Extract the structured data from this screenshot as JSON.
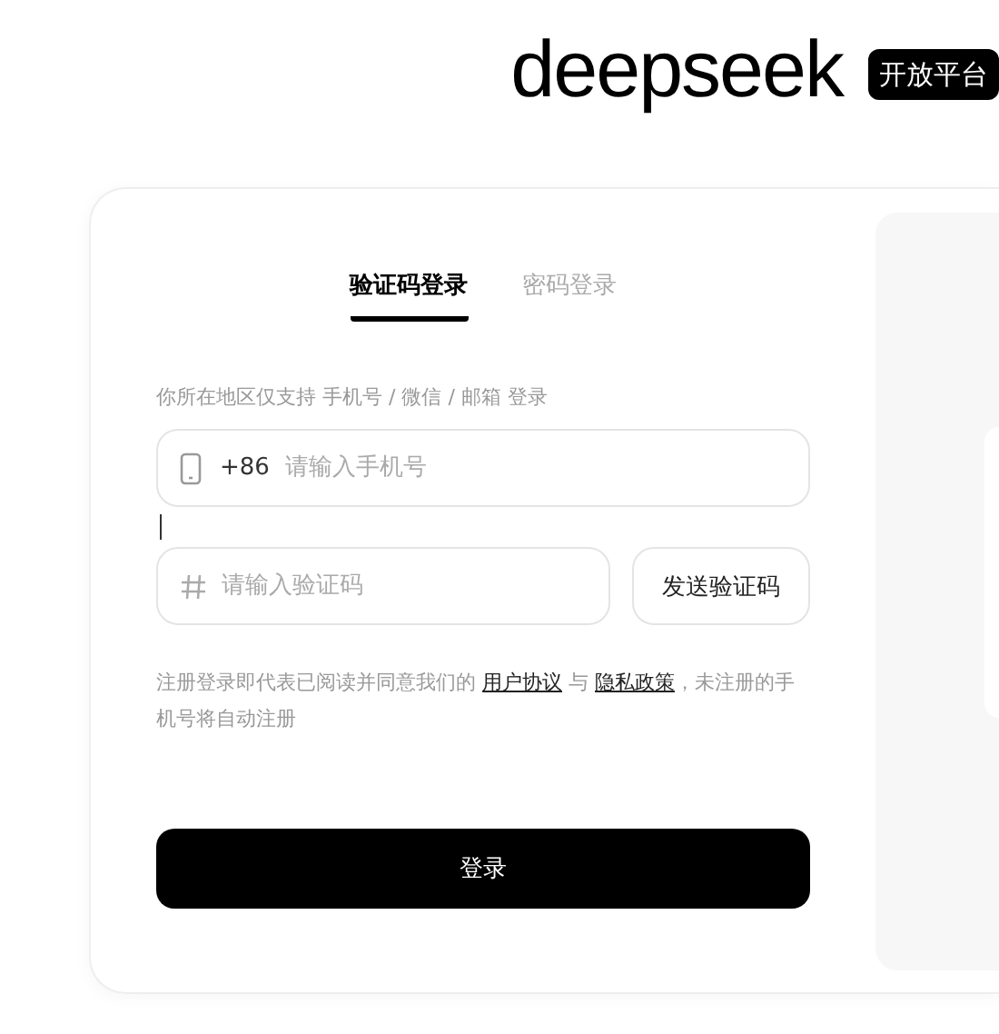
{
  "header": {
    "logo": "deepseek",
    "badge": "开放平台"
  },
  "tabs": [
    {
      "label": "验证码登录",
      "selected": true
    },
    {
      "label": "密码登录",
      "selected": false
    }
  ],
  "hint": "你所在地区仅支持 手机号 / 微信 / 邮箱 登录",
  "phone_field": {
    "prefix": "+86",
    "placeholder": "请输入手机号"
  },
  "code_field": {
    "placeholder": "请输入验证码"
  },
  "send_code_button": "发送验证码",
  "agreement": [
    {
      "kind": "text",
      "text": "注册登录即代表已阅读并同意我们的 "
    },
    {
      "kind": "link",
      "text": "用户协议"
    },
    {
      "kind": "text",
      "text": " 与 "
    },
    {
      "kind": "link",
      "text": "隐私政策"
    },
    {
      "kind": "text",
      "text": "，未注册的手机号将自动注册"
    }
  ],
  "login_button": "登录"
}
